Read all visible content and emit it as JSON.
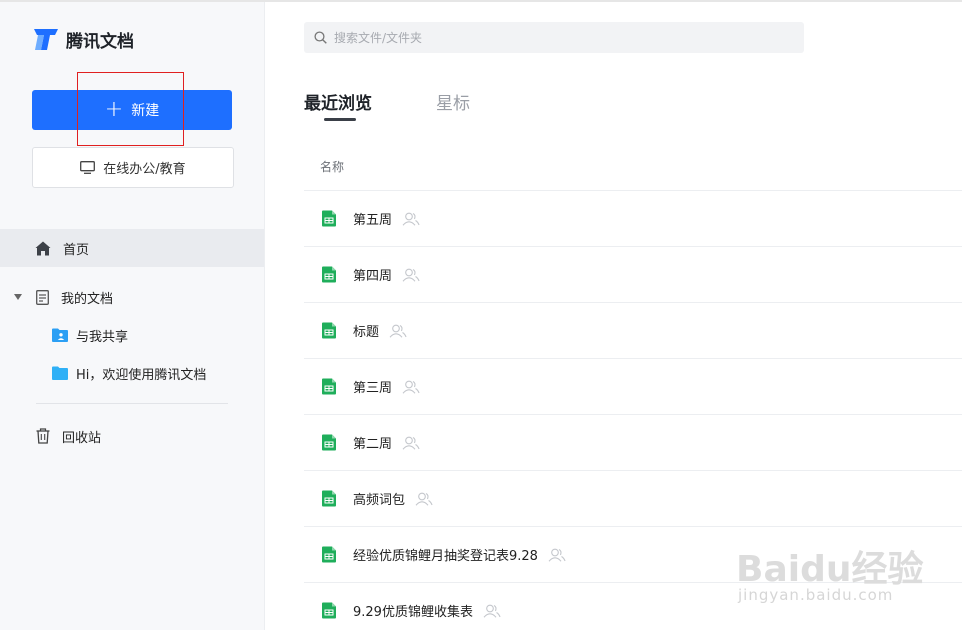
{
  "app": {
    "name": "腾讯文档",
    "brand_color": "#1e6fff"
  },
  "sidebar": {
    "new_button": {
      "icon": "plus-icon",
      "label": "新建"
    },
    "office_button": {
      "icon": "monitor-icon",
      "label": "在线办公/教育"
    },
    "nav": {
      "home": {
        "icon": "home-icon",
        "label": "首页"
      },
      "my_docs": {
        "icon": "document-list-icon",
        "label": "我的文档",
        "expanded": true
      },
      "shared": {
        "icon": "shared-folder-icon",
        "label": "与我共享"
      },
      "welcome": {
        "icon": "folder-icon",
        "label": "Hi，欢迎使用腾讯文档"
      },
      "trash": {
        "icon": "trash-icon",
        "label": "回收站"
      }
    }
  },
  "search": {
    "placeholder": "搜索文件/文件夹",
    "icon": "search-icon"
  },
  "tabs": {
    "recent": {
      "label": "最近浏览",
      "active": true
    },
    "starred": {
      "label": "星标",
      "active": false
    }
  },
  "list": {
    "column_name": "名称",
    "items": [
      {
        "name": "第五周",
        "icon": "sheet-icon"
      },
      {
        "name": "第四周",
        "icon": "sheet-icon"
      },
      {
        "name": "标题",
        "icon": "sheet-icon"
      },
      {
        "name": "第三周",
        "icon": "sheet-icon"
      },
      {
        "name": "第二周",
        "icon": "sheet-icon"
      },
      {
        "name": "高频词包",
        "icon": "sheet-icon"
      },
      {
        "name": "经验优质锦鲤月抽奖登记表9.28",
        "icon": "sheet-icon"
      },
      {
        "name": "9.29优质锦鲤收集表",
        "icon": "sheet-icon"
      }
    ]
  },
  "watermark": {
    "text": "Baidu经验",
    "sub": "jingyan.baidu.com"
  }
}
